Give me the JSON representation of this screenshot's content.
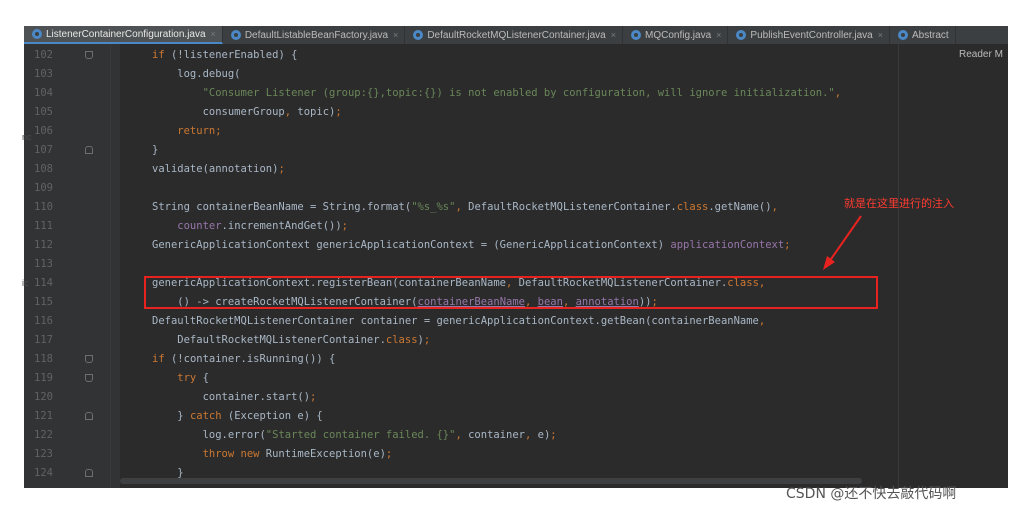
{
  "tabs": [
    {
      "label": "ListenerContainerConfiguration.java",
      "active": true,
      "color": "#4a88c7"
    },
    {
      "label": "DefaultListableBeanFactory.java",
      "active": false,
      "color": "#4a88c7"
    },
    {
      "label": "DefaultRocketMQListenerContainer.java",
      "active": false,
      "color": "#4a88c7"
    },
    {
      "label": "MQConfig.java",
      "active": false,
      "color": "#4a88c7"
    },
    {
      "label": "PublishEventController.java",
      "active": false,
      "color": "#4a88c7"
    },
    {
      "label": "Abstract",
      "active": false,
      "color": "#4a88c7"
    }
  ],
  "tab_close_glyph": "×",
  "reader_mode_label": "Reader M",
  "edge_glyphs": {
    "left_a": "nc",
    "left_b": "ic"
  },
  "code_lines": [
    {
      "num": "102",
      "fold": "open",
      "parts": [
        [
          "kw",
          "if"
        ],
        [
          "pl",
          " (!listenerEnabled) {"
        ]
      ]
    },
    {
      "num": "103",
      "fold": "",
      "parts": [
        [
          "pl",
          "    log.debug("
        ]
      ]
    },
    {
      "num": "104",
      "fold": "",
      "parts": [
        [
          "str",
          "        \"Consumer Listener (group:{},topic:{}) is not enabled by configuration, will ignore initialization.\""
        ],
        [
          "kw",
          ","
        ]
      ]
    },
    {
      "num": "105",
      "fold": "",
      "parts": [
        [
          "pl",
          "        consumerGroup"
        ],
        [
          "kw",
          ","
        ],
        [
          "pl",
          " topic)"
        ],
        [
          "kw",
          ";"
        ]
      ]
    },
    {
      "num": "106",
      "fold": "",
      "parts": [
        [
          "kw",
          "    return;"
        ]
      ]
    },
    {
      "num": "107",
      "fold": "close",
      "parts": [
        [
          "pl",
          "}"
        ]
      ]
    },
    {
      "num": "108",
      "fold": "",
      "parts": [
        [
          "pl",
          "validate(annotation)"
        ],
        [
          "kw",
          ";"
        ]
      ]
    },
    {
      "num": "109",
      "fold": "",
      "parts": []
    },
    {
      "num": "110",
      "fold": "",
      "parts": [
        [
          "pl",
          "String containerBeanName = String."
        ],
        [
          "pl",
          "format("
        ],
        [
          "str",
          "\"%s_%s\""
        ],
        [
          "kw",
          ","
        ],
        [
          "pl",
          " DefaultRocketMQListenerContainer."
        ],
        [
          "kw",
          "class"
        ],
        [
          "pl",
          ".getName()"
        ],
        [
          "kw",
          ","
        ]
      ]
    },
    {
      "num": "111",
      "fold": "",
      "parts": [
        [
          "fld",
          "    counter"
        ],
        [
          "pl",
          ".incrementAndGet())"
        ],
        [
          "kw",
          ";"
        ]
      ]
    },
    {
      "num": "112",
      "fold": "",
      "parts": [
        [
          "pl",
          "GenericApplicationContext genericApplicationContext = (GenericApplicationContext) "
        ],
        [
          "fld",
          "applicationContext"
        ],
        [
          "kw",
          ";"
        ]
      ]
    },
    {
      "num": "113",
      "fold": "",
      "parts": []
    },
    {
      "num": "114",
      "fold": "",
      "parts": [
        [
          "pl",
          "genericApplicationContext.registerBean(containerBeanName"
        ],
        [
          "kw",
          ","
        ],
        [
          "pl",
          " DefaultRocketMQListenerContainer."
        ],
        [
          "kw",
          "class,"
        ]
      ]
    },
    {
      "num": "115",
      "fold": "",
      "parts": [
        [
          "pl",
          "    () -> createRocketMQListenerContainer("
        ],
        [
          "ful",
          "containerBeanName"
        ],
        [
          "kw",
          ","
        ],
        [
          "pl",
          " "
        ],
        [
          "ful",
          "bean"
        ],
        [
          "kw",
          ","
        ],
        [
          "pl",
          " "
        ],
        [
          "ful",
          "annotation"
        ],
        [
          "pl",
          "))"
        ],
        [
          "kw",
          ";"
        ]
      ]
    },
    {
      "num": "116",
      "fold": "",
      "parts": [
        [
          "pl",
          "DefaultRocketMQListenerContainer container = genericApplicationContext.getBean(containerBeanName"
        ],
        [
          "kw",
          ","
        ]
      ]
    },
    {
      "num": "117",
      "fold": "",
      "parts": [
        [
          "pl",
          "    DefaultRocketMQListenerContainer."
        ],
        [
          "kw",
          "class"
        ],
        [
          "pl",
          ")"
        ],
        [
          "kw",
          ";"
        ]
      ]
    },
    {
      "num": "118",
      "fold": "open",
      "parts": [
        [
          "kw",
          "if"
        ],
        [
          "pl",
          " (!container.isRunning()) {"
        ]
      ]
    },
    {
      "num": "119",
      "fold": "open",
      "parts": [
        [
          "kw",
          "    try"
        ],
        [
          "pl",
          " {"
        ]
      ]
    },
    {
      "num": "120",
      "fold": "",
      "parts": [
        [
          "pl",
          "        container.start()"
        ],
        [
          "kw",
          ";"
        ]
      ]
    },
    {
      "num": "121",
      "fold": "close",
      "parts": [
        [
          "pl",
          "    } "
        ],
        [
          "kw",
          "catch"
        ],
        [
          "pl",
          " (Exception e) {"
        ]
      ]
    },
    {
      "num": "122",
      "fold": "",
      "parts": [
        [
          "pl",
          "        log.error("
        ],
        [
          "str",
          "\"Started container failed. {}\""
        ],
        [
          "kw",
          ","
        ],
        [
          "pl",
          " container"
        ],
        [
          "kw",
          ","
        ],
        [
          "pl",
          " e)"
        ],
        [
          "kw",
          ";"
        ]
      ]
    },
    {
      "num": "123",
      "fold": "",
      "parts": [
        [
          "kw",
          "        throw new"
        ],
        [
          "pl",
          " RuntimeException(e)"
        ],
        [
          "kw",
          ";"
        ]
      ]
    },
    {
      "num": "124",
      "fold": "close",
      "parts": [
        [
          "pl",
          "    }"
        ]
      ]
    }
  ],
  "annotation": {
    "text": "就是在这里进行的注入",
    "color": "#ff3b30",
    "box_color": "#e8231f"
  },
  "watermark": "CSDN @还不快去敲代码啊",
  "colors": {
    "editor_bg": "#2b2b2b",
    "gutter_bg": "#313335",
    "keyword": "#cc7832",
    "string": "#6a8759",
    "field": "#9876aa",
    "plain": "#a9b7c6",
    "line_number": "#606366"
  }
}
